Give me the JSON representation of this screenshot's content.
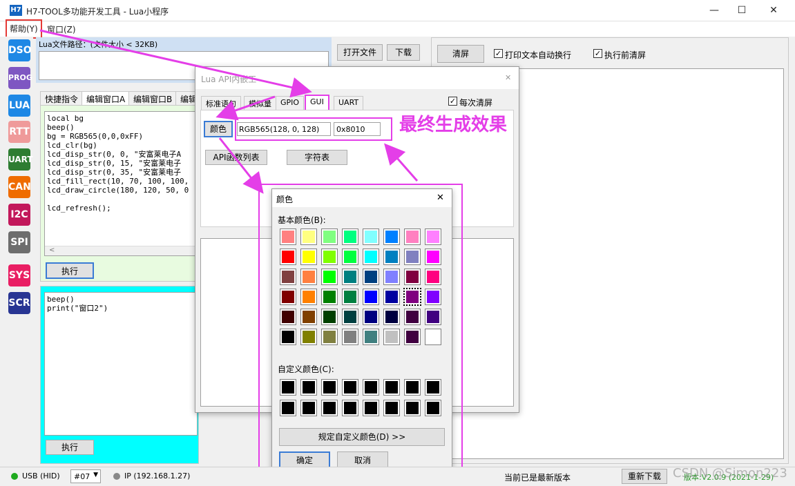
{
  "window": {
    "logo": "H7",
    "title": "H7-TOOL多功能开发工具 - Lua小程序",
    "controls": [
      "—",
      "☐",
      "✕"
    ]
  },
  "menu": {
    "help": "帮助(Y)",
    "window": "窗口(Z)"
  },
  "sidebar": {
    "items": [
      {
        "label": "DSO",
        "color": "#1e88e5"
      },
      {
        "label": "PROG",
        "color": "#7e57c2"
      },
      {
        "label": "LUA",
        "color": "#1e88e5"
      },
      {
        "label": "RTT",
        "color": "#ef9a9a"
      },
      {
        "label": "UART",
        "color": "#2e7d32"
      },
      {
        "label": "CAN",
        "color": "#ef6c00"
      },
      {
        "label": "I2C",
        "color": "#c2185b"
      },
      {
        "label": "SPI",
        "color": "#6d6d6d"
      },
      {
        "label": "SYS",
        "color": "#e91e63"
      },
      {
        "label": "SCR",
        "color": "#283593"
      }
    ]
  },
  "lua": {
    "path_label": "Lua文件路径：(文件大小 < 32KB)",
    "open_file": "打开文件",
    "download": "下载",
    "tabs": [
      "快捷指令",
      "编辑窗口A",
      "编辑窗口B",
      "编辑"
    ],
    "code_a": "local bg\nbeep()\nbg = RGB565(0,0,0xFF)\nlcd_clr(bg)\nlcd_disp_str(0, 0, \"安富莱电子A\nlcd_disp_str(0, 15, \"安富莱电子\nlcd_disp_str(0, 35, \"安富莱电子\nlcd_fill_rect(10, 70, 100, 100,\nlcd_draw_circle(180, 120, 50, 0\n\nlcd_refresh();",
    "run_a": "执行",
    "code_b": "beep()\nprint(\"窗口2\")",
    "run_b": "执行",
    "scroll_left": "<"
  },
  "right_panel": {
    "clear": "清屏",
    "auto_wrap": "打印文本自动换行",
    "clear_before": "执行前清屏",
    "check": "✓"
  },
  "api_dialog": {
    "title": "Lua API内嵌工",
    "tabs": [
      "标准语句",
      "模拟量",
      "GPIO",
      "GUI",
      "UART"
    ],
    "clear_each": "每次清屏",
    "color_button": "颜色",
    "rgb_value": "RGB565(128, 0, 128)",
    "hex_value": "0x8010",
    "api_list": "API函数列表",
    "char_table": "字符表",
    "close": "✕"
  },
  "annotation": {
    "text": "最终生成效果",
    "color": "#e43ee8"
  },
  "color_dialog": {
    "title": "颜色",
    "close": "✕",
    "basic_label": "基本颜色(B):",
    "custom_label": "自定义颜色(C):",
    "define_custom": "规定自定义颜色(D) >>",
    "ok": "确定",
    "cancel": "取消",
    "selected": "#800080",
    "basic_colors": [
      "#ff8080",
      "#ffff80",
      "#80ff80",
      "#00ff80",
      "#80ffff",
      "#0080ff",
      "#ff80c0",
      "#ff80ff",
      "#ff0000",
      "#ffff00",
      "#80ff00",
      "#00ff40",
      "#00ffff",
      "#0080c0",
      "#8080c0",
      "#ff00ff",
      "#804040",
      "#ff8040",
      "#00ff00",
      "#008080",
      "#004080",
      "#8080ff",
      "#800040",
      "#ff0080",
      "#800000",
      "#ff8000",
      "#008000",
      "#008040",
      "#0000ff",
      "#0000a0",
      "#800080",
      "#8000ff",
      "#400000",
      "#804000",
      "#004000",
      "#004040",
      "#000080",
      "#000040",
      "#400040",
      "#400080",
      "#000000",
      "#808000",
      "#808040",
      "#808080",
      "#408080",
      "#c0c0c0",
      "#400040",
      "#ffffff"
    ]
  },
  "status": {
    "usb": "USB (HID)",
    "port": "#07",
    "ip": "IP (192.168.1.27)",
    "latest": "当前已是最新版本",
    "reload": "重新下载",
    "version": "版本:V2.0.9 (2021-1-29)",
    "watermark": "CSDN @Simon223"
  }
}
